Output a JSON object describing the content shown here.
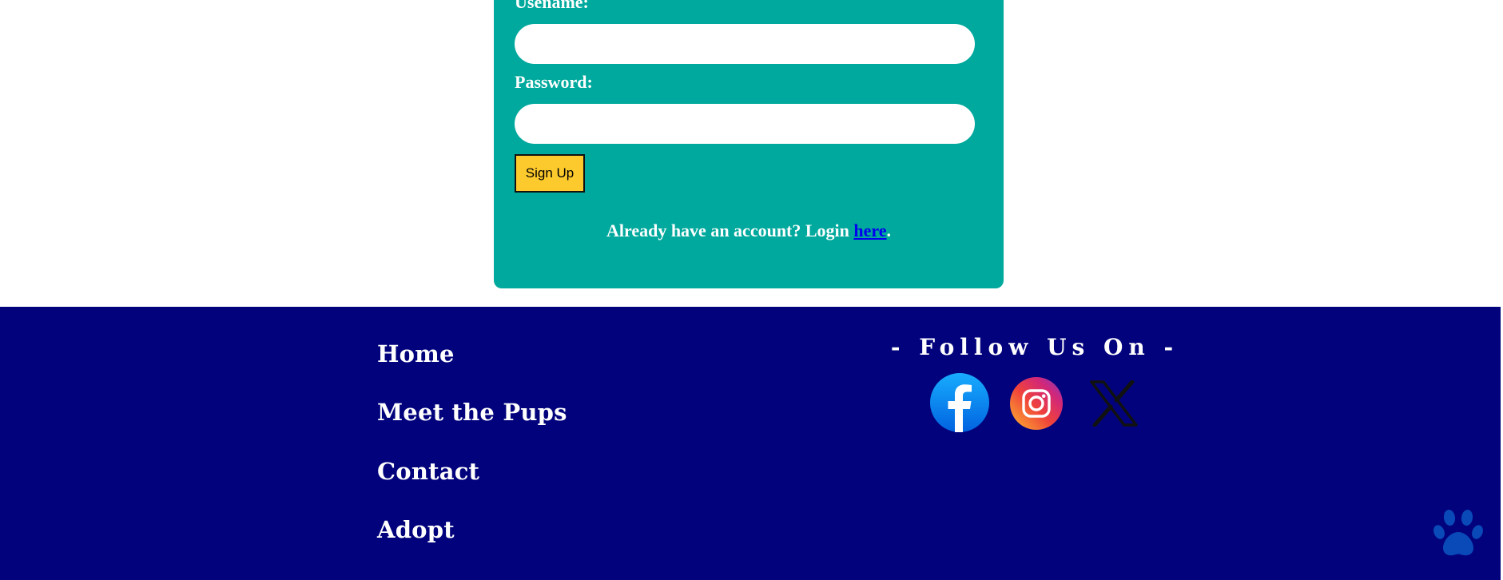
{
  "form": {
    "username_label": "Usename:",
    "username_value": "",
    "password_label": "Password:",
    "password_value": "",
    "signup_label": "Sign Up",
    "login_prefix": "Already have an account? Login ",
    "login_link": "here",
    "login_suffix": "."
  },
  "footer": {
    "nav": [
      "Home",
      "Meet the Pups",
      "Contact",
      "Adopt"
    ],
    "follow_title": "- Follow Us On -",
    "socials": [
      "facebook-icon",
      "instagram-icon",
      "x-icon"
    ]
  },
  "colors": {
    "card": "#00a99d",
    "footer": "#02037c",
    "button": "#fdca2e",
    "link": "#0000ee"
  }
}
